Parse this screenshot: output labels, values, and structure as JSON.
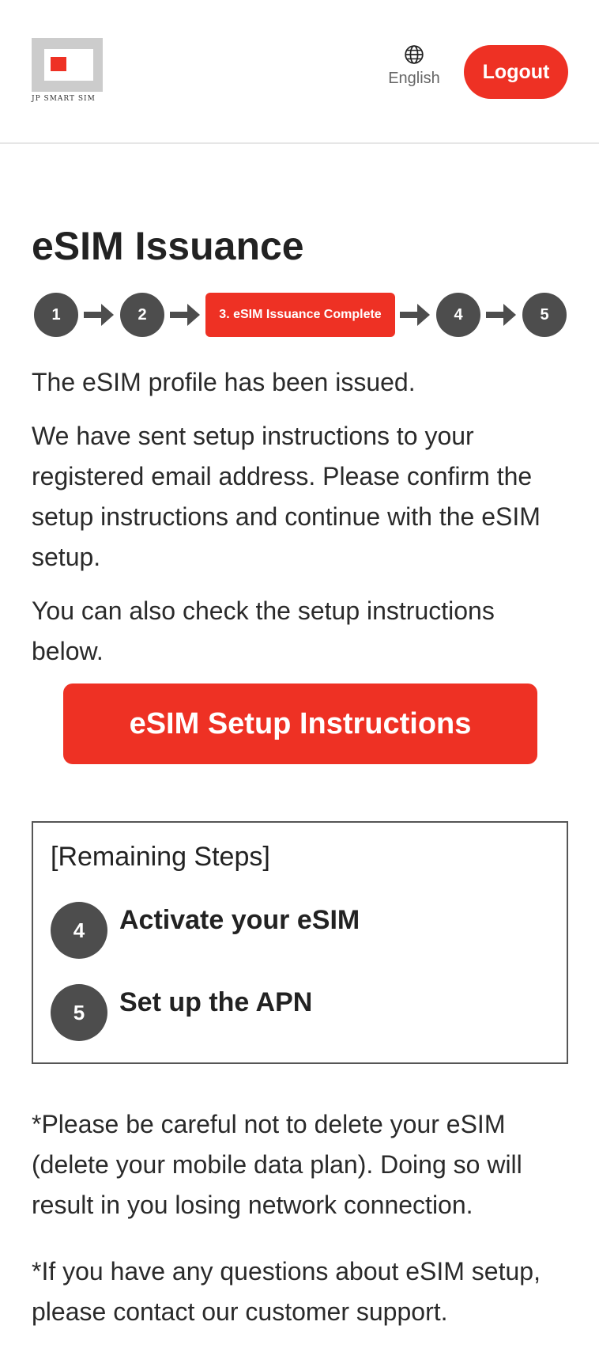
{
  "header": {
    "logo_text": "JP SMART SIM",
    "language_label": "English",
    "logout_label": "Logout"
  },
  "page_title": "eSIM Issuance",
  "stepper": {
    "steps": [
      "1",
      "2",
      "3. eSIM Issuance Complete",
      "4",
      "5"
    ],
    "current_index": 2
  },
  "content": {
    "issued_text": "The eSIM profile has been issued.",
    "instructions_text": "We have sent setup instructions to your registered email address. Please confirm the setup instructions and continue with the eSIM setup.",
    "check_text": "You can also check the setup instructions below.",
    "setup_button_label": "eSIM Setup Instructions"
  },
  "remaining": {
    "title": "[Remaining Steps]",
    "items": [
      {
        "number": "4",
        "label": "Activate your eSIM"
      },
      {
        "number": "5",
        "label": "Set up the APN"
      }
    ]
  },
  "notes": {
    "warning": "*Please be careful not to delete your eSIM (delete your mobile data plan). Doing so will result in you losing network connection.",
    "support": "*If you have any questions about eSIM setup, please contact our customer support."
  },
  "colors": {
    "accent": "#ee3124",
    "step_gray": "#4d4d4d",
    "text": "#222222"
  },
  "icons": {
    "language": "globe-icon",
    "arrow": "arrow-right-icon"
  }
}
